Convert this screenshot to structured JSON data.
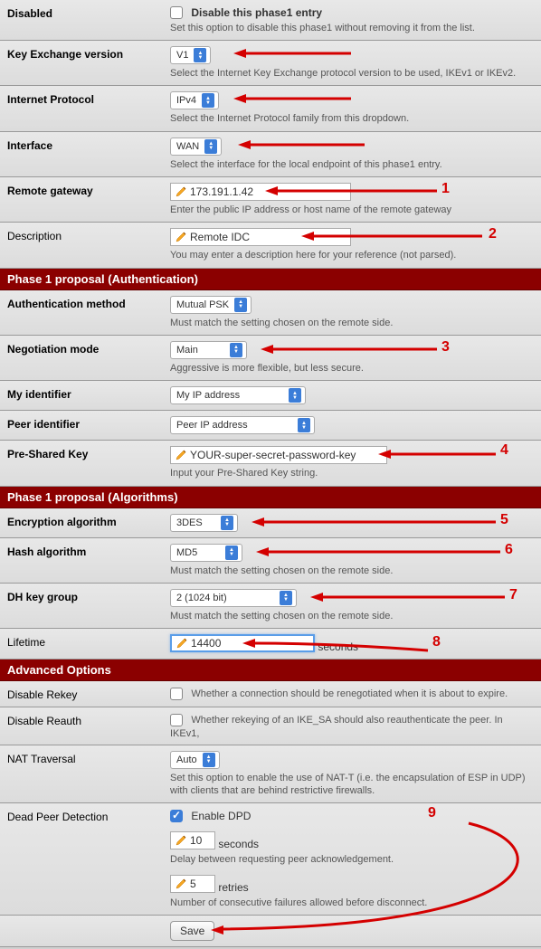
{
  "general": {
    "disabled_label": "Disabled",
    "disabled_checkbox_label": "Disable this phase1 entry",
    "disabled_help": "Set this option to disable this phase1 without removing it from the list.",
    "key_exchange_label": "Key Exchange version",
    "key_exchange_value": "V1",
    "key_exchange_help": "Select the Internet Key Exchange protocol version to be used, IKEv1 or IKEv2.",
    "internet_protocol_label": "Internet Protocol",
    "internet_protocol_value": "IPv4",
    "internet_protocol_help": "Select the Internet Protocol family from this dropdown.",
    "interface_label": "Interface",
    "interface_value": "WAN",
    "interface_help": "Select the interface for the local endpoint of this phase1 entry.",
    "remote_gw_label": "Remote gateway",
    "remote_gw_value": "173.191.1.42",
    "remote_gw_help": "Enter the public IP address or host name of the remote gateway",
    "description_label": "Description",
    "description_value": "Remote IDC",
    "description_help": "You may enter a description here for your reference (not parsed)."
  },
  "section_auth": "Phase 1 proposal (Authentication)",
  "auth": {
    "method_label": "Authentication method",
    "method_value": "Mutual PSK",
    "method_help": "Must match the setting chosen on the remote side.",
    "neg_label": "Negotiation mode",
    "neg_value": "Main",
    "neg_help": "Aggressive is more flexible, but less secure.",
    "myid_label": "My identifier",
    "myid_value": "My IP address",
    "peerid_label": "Peer identifier",
    "peerid_value": "Peer IP address",
    "psk_label": "Pre-Shared Key",
    "psk_value": "YOUR-super-secret-password-key",
    "psk_help": "Input your Pre-Shared Key string."
  },
  "section_algo": "Phase 1 proposal (Algorithms)",
  "algo": {
    "enc_label": "Encryption algorithm",
    "enc_value": "3DES",
    "hash_label": "Hash algorithm",
    "hash_value": "MD5",
    "hash_help": "Must match the setting chosen on the remote side.",
    "dh_label": "DH key group",
    "dh_value": "2 (1024 bit)",
    "dh_help": "Must match the setting chosen on the remote side.",
    "lifetime_label": "Lifetime",
    "lifetime_value": "14400",
    "lifetime_unit": "seconds"
  },
  "section_adv": "Advanced Options",
  "adv": {
    "rekey_label": "Disable Rekey",
    "rekey_help": "Whether a connection should be renegotiated when it is about to expire.",
    "reauth_label": "Disable Reauth",
    "reauth_help": "Whether rekeying of an IKE_SA should also reauthenticate the peer. In IKEv1,",
    "nat_label": "NAT Traversal",
    "nat_value": "Auto",
    "nat_help": "Set this option to enable the use of NAT-T (i.e. the encapsulation of ESP in UDP) with clients that are behind restrictive firewalls.",
    "dpd_label": "Dead Peer Detection",
    "dpd_checkbox_label": "Enable DPD",
    "dpd_seconds_value": "10",
    "dpd_seconds_unit": "seconds",
    "dpd_seconds_help": "Delay between requesting peer acknowledgement.",
    "dpd_retries_value": "5",
    "dpd_retries_unit": "retries",
    "dpd_retries_help": "Number of consecutive failures allowed before disconnect."
  },
  "save_label": "Save",
  "callouts": {
    "c1": "1",
    "c2": "2",
    "c3": "3",
    "c4": "4",
    "c5": "5",
    "c6": "6",
    "c7": "7",
    "c8": "8",
    "c9": "9"
  }
}
